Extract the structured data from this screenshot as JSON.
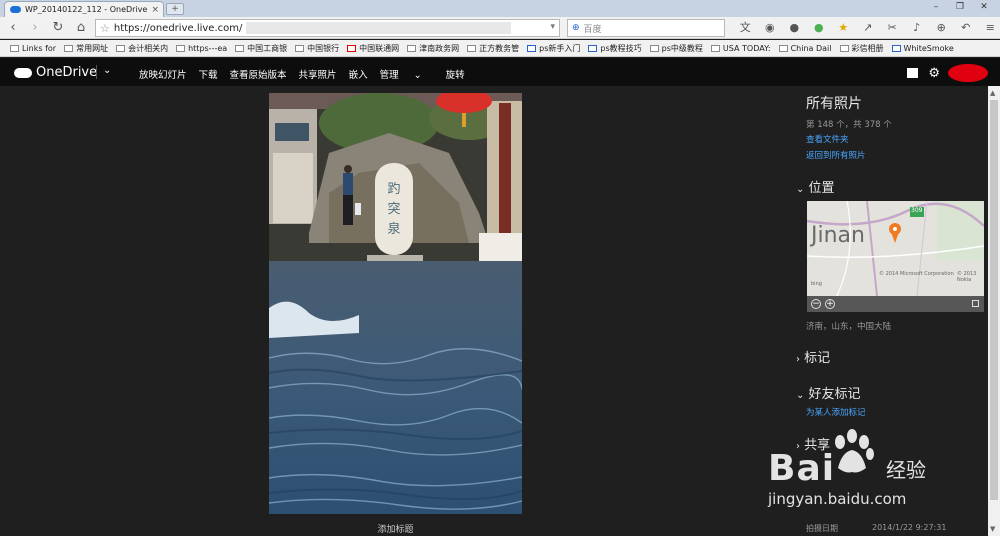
{
  "browser": {
    "tab_title": "WP_20140122_112 - OneDrive",
    "new_tab": "+",
    "url": "https://onedrive.live.com/",
    "search_placeholder": "百度",
    "bookmarks": [
      "Links for",
      "常用网址",
      "会计相关内",
      "https---ea",
      "中国工商银",
      "中国银行",
      "中国联通网",
      "津南政务网",
      "正方教务管",
      "ps新手入门",
      "ps教程技巧",
      "ps中级教程",
      "USA TODAY:",
      "China Dail",
      "彩信相册",
      "WhiteSmoke"
    ]
  },
  "onedrive": {
    "logo": "OneDrive",
    "menu": [
      "放映幻灯片",
      "下载",
      "查看原始版本",
      "共享照片",
      "嵌入",
      "管理",
      "旋转"
    ]
  },
  "photo": {
    "caption": "添加标题"
  },
  "panel": {
    "title": "所有照片",
    "count": "第 148 个，共 378 个",
    "view_folder": "查看文件夹",
    "back_all": "返回到所有照片",
    "location_heading": "位置",
    "map_city": "Jinan",
    "map_road": "309",
    "map_copyright": "© 2014 Microsoft Corporation",
    "map_copyright2": "© 2013 Nokia",
    "map_brand": "bing",
    "location_text": "济南，山东，中国大陆",
    "tags_heading": "标记",
    "friend_tags_heading": "好友标记",
    "add_tag": "为某人添加标记",
    "share_heading": "共享",
    "date_label": "拍摄日期",
    "date_value": "2014/1/22 9:27:31"
  },
  "watermark": {
    "brand": "Bai",
    "jingyan": "经验",
    "url": "jingyan.baidu.com"
  }
}
